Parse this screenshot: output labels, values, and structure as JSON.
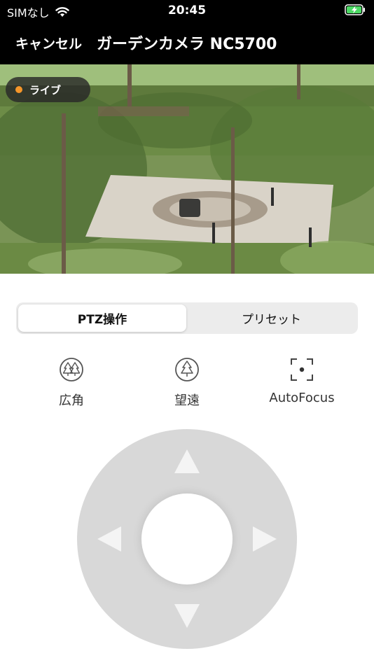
{
  "status_bar": {
    "carrier": "SIMなし",
    "time": "20:45",
    "wifi_icon": "wifi-icon",
    "battery_icon": "battery-charging-icon",
    "battery_color": "#4cd964"
  },
  "nav": {
    "cancel_label": "キャンセル",
    "title": "ガーデンカメラ NC5700"
  },
  "video": {
    "live_label": "ライブ",
    "live_dot_color": "#f5962a"
  },
  "tabs": {
    "ptz_label": "PTZ操作",
    "preset_label": "プリセット",
    "selected": "PTZ操作"
  },
  "controls": {
    "wide_label": "広角",
    "wide_icon": "tree-wide-icon",
    "tele_label": "望遠",
    "tele_icon": "tree-tele-icon",
    "autofocus_label": "AutoFocus",
    "autofocus_icon": "focus-frame-icon"
  },
  "dpad": {
    "up_icon": "arrow-up-icon",
    "down_icon": "arrow-down-icon",
    "left_icon": "arrow-left-icon",
    "right_icon": "arrow-right-icon"
  }
}
